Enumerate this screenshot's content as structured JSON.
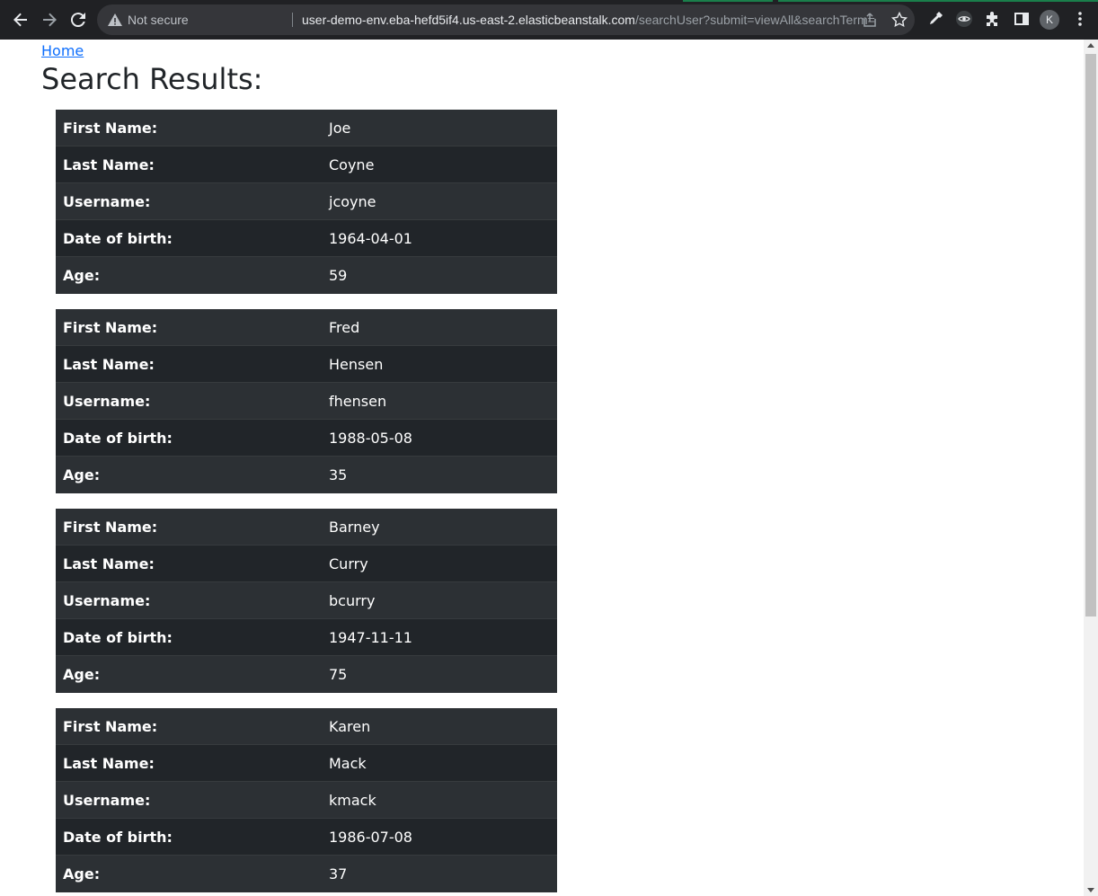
{
  "browser": {
    "security_label": "Not secure",
    "url_host": "user-demo-env.eba-hefd5if4.us-east-2.elasticbeanstalk.com",
    "url_path": "/searchUser?submit=viewAll&searchTerm=",
    "profile_initial": "K"
  },
  "page": {
    "home_link": "Home",
    "title": "Search Results:"
  },
  "field_labels": {
    "first_name": "First Name:",
    "last_name": "Last Name:",
    "username": "Username:",
    "dob": "Date of birth:",
    "age": "Age:"
  },
  "users": [
    {
      "first_name": "Joe",
      "last_name": "Coyne",
      "username": "jcoyne",
      "dob": "1964-04-01",
      "age": "59"
    },
    {
      "first_name": "Fred",
      "last_name": "Hensen",
      "username": "fhensen",
      "dob": "1988-05-08",
      "age": "35"
    },
    {
      "first_name": "Barney",
      "last_name": "Curry",
      "username": "bcurry",
      "dob": "1947-11-11",
      "age": "75"
    },
    {
      "first_name": "Karen",
      "last_name": "Mack",
      "username": "kmack",
      "dob": "1986-07-08",
      "age": "37"
    }
  ],
  "colors": {
    "table_dark": "#212529",
    "table_stripe": "#2c3034",
    "link": "#0d6efd",
    "chrome_bg": "#202124"
  }
}
